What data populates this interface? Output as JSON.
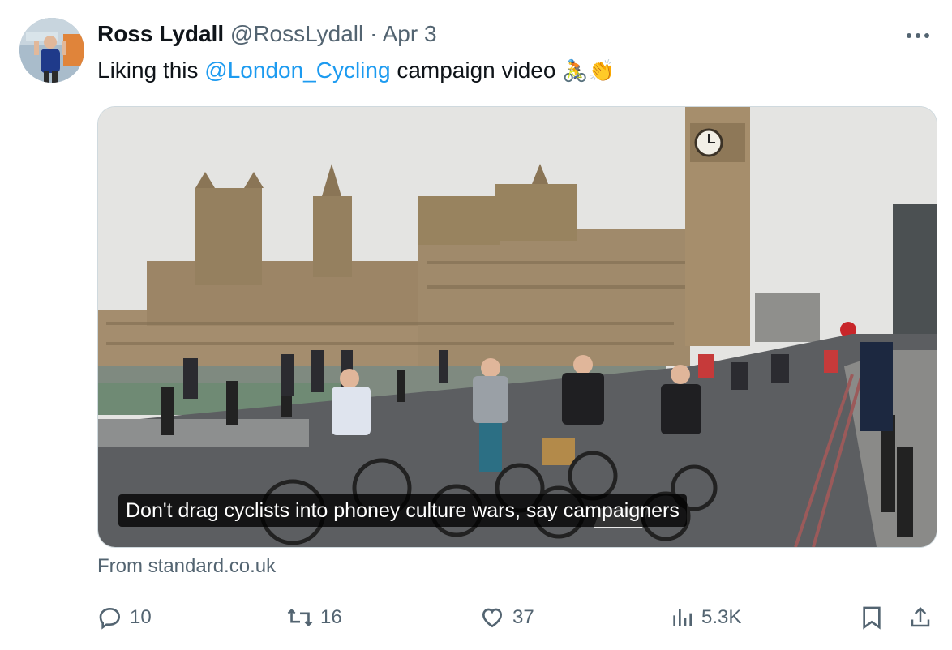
{
  "author": {
    "name": "Ross Lydall",
    "handle": "@RossLydall",
    "separator": "·",
    "time": "Apr 3"
  },
  "tweet": {
    "text_before": "Liking this ",
    "mention": "@London_Cycling",
    "text_after": " campaign video ",
    "emoji": "🚴👏"
  },
  "media": {
    "caption": "Don't drag cyclists into phoney culture wars, say campaigners",
    "source": "From standard.co.uk"
  },
  "actions": {
    "replies": "10",
    "reposts": "16",
    "likes": "37",
    "views": "5.3K"
  },
  "icons": {
    "more": "more-horizontal-icon",
    "reply": "reply-icon",
    "repost": "repost-icon",
    "like": "heart-icon",
    "views": "analytics-icon",
    "bookmark": "bookmark-icon",
    "share": "share-icon"
  },
  "colors": {
    "text": "#0f1419",
    "secondary": "#536471",
    "link": "#1d9bf0",
    "border": "#cfd9de"
  }
}
